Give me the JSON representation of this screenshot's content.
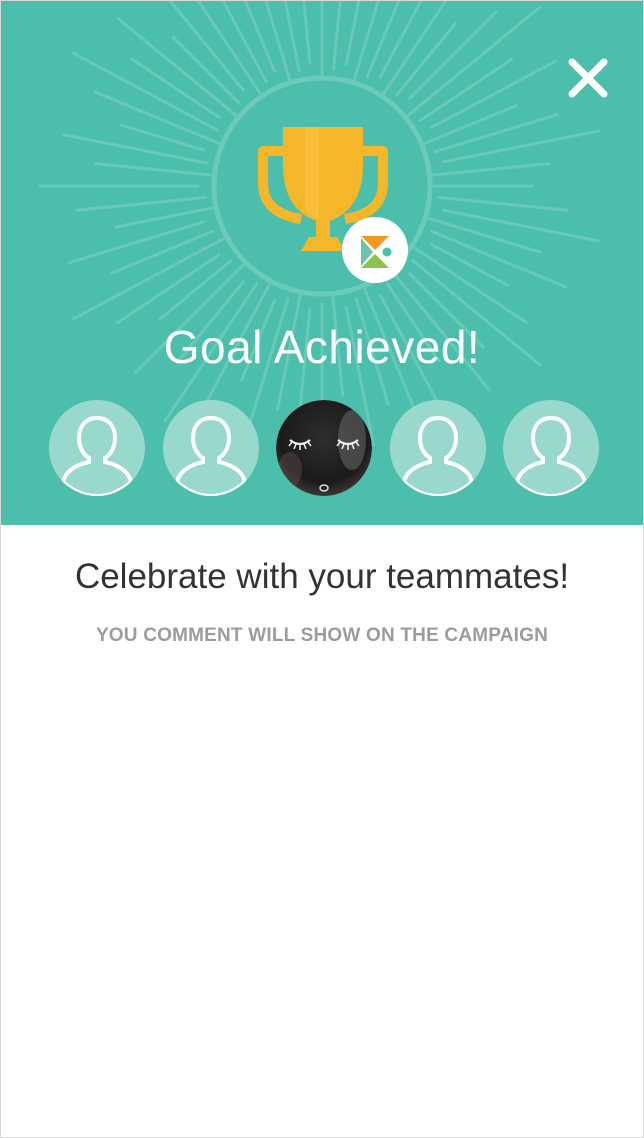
{
  "hero": {
    "title": "Goal Achieved!",
    "background_color": "#4cbfac",
    "trophy_icon": "trophy-icon",
    "badge_icon": "app-logo-badge-icon",
    "close_icon": "close-icon"
  },
  "teammates": [
    {
      "type": "placeholder",
      "icon": "user-silhouette-icon"
    },
    {
      "type": "placeholder",
      "icon": "user-silhouette-icon"
    },
    {
      "type": "photo",
      "icon": "profile-photo"
    },
    {
      "type": "placeholder",
      "icon": "user-silhouette-icon"
    },
    {
      "type": "placeholder",
      "icon": "user-silhouette-icon"
    }
  ],
  "content": {
    "heading": "Celebrate with your teammates!",
    "caption": "YOU COMMENT WILL SHOW ON THE CAMPAIGN"
  },
  "colors": {
    "trophy": "#f6b62a",
    "text_dark": "#333333",
    "text_muted": "#9c9c9c"
  }
}
